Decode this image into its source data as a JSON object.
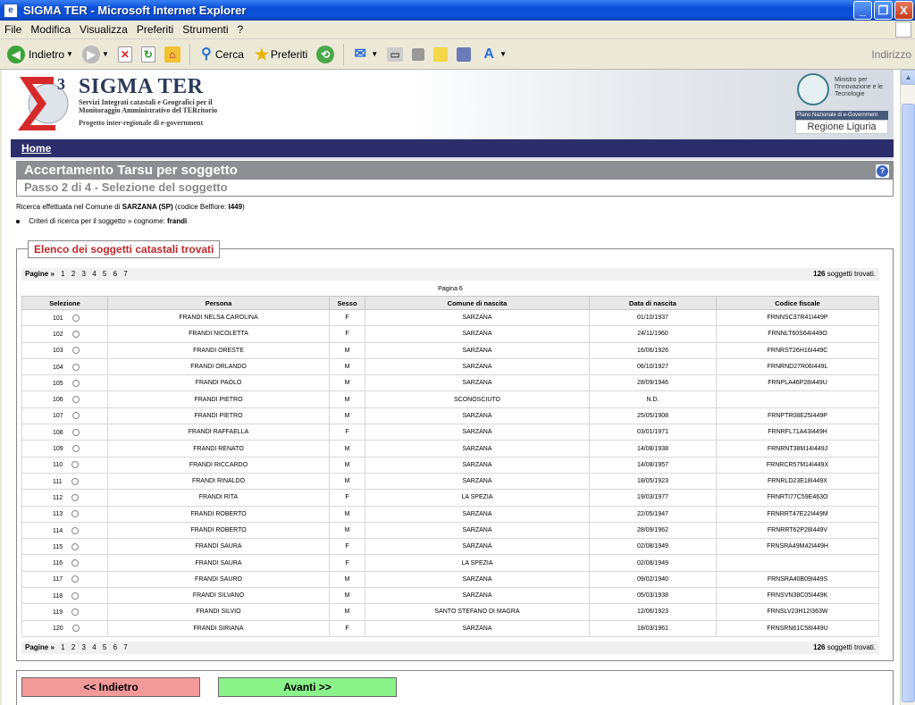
{
  "window": {
    "title": "SIGMA TER - Microsoft Internet Explorer",
    "minimize": "_",
    "maximize": "❐",
    "close": "X"
  },
  "menu": [
    "File",
    "Modifica",
    "Visualizza",
    "Preferiti",
    "Strumenti",
    "?"
  ],
  "toolbar": {
    "back_label": "Indietro",
    "search_label": "Cerca",
    "favorites_label": "Preferiti",
    "address_label": "Indirizzo"
  },
  "banner": {
    "title": "SIGMA TER",
    "subtitle": "Servizi Integrati catastali e Geografici per il Monitoraggio Amministrativo del TERritorio",
    "project": "Progetto inter-regionale di e-government",
    "ministry": "Ministro per l'Innovazione e le Tecnologie",
    "egov": "Piano Nazionale di e-Government",
    "regione": "Regione Liguria"
  },
  "nav": {
    "home": "Home"
  },
  "section": {
    "title": "Accertamento Tarsu per soggetto",
    "step": "Passo 2 di 4 - Selezione del soggetto"
  },
  "info": {
    "line1_prefix": "Ricerca effettuata nel Comune di",
    "comune": "SARZANA (SP)",
    "belfiore_prefix": "(codice Belfiore:",
    "belfiore": "I449",
    "belfiore_suffix": ")",
    "criteria_prefix": "Criteri di ricerca per il soggetto » cognome:",
    "cognome": "frandi"
  },
  "list": {
    "legend": "Elenco dei soggetti catastali trovati",
    "pages_label": "Pagine »",
    "pages": [
      "1",
      "2",
      "3",
      "4",
      "5",
      "6",
      "7"
    ],
    "count": "126",
    "count_suffix": "soggetti trovati.",
    "current_page": "Pagina 6",
    "headers": [
      "Selezione",
      "Persona",
      "Sesso",
      "Comune di nascita",
      "Data di nascita",
      "Codice fiscale"
    ],
    "rows": [
      [
        "101",
        "FRANDI NELSA CAROLINA",
        "F",
        "SARZANA",
        "01/10/1937",
        "FRNNSC37R41I449P"
      ],
      [
        "102",
        "FRANDI NICOLETTA",
        "F",
        "SARZANA",
        "24/11/1960",
        "FRNNLT60S64I449O"
      ],
      [
        "103",
        "FRANDI ORESTE",
        "M",
        "SARZANA",
        "16/06/1926",
        "FRNRST26H16I449C"
      ],
      [
        "104",
        "FRANDI ORLANDO",
        "M",
        "SARZANA",
        "06/10/1927",
        "FRNRND27R06I449L"
      ],
      [
        "105",
        "FRANDI PAOLO",
        "M",
        "SARZANA",
        "28/09/1946",
        "FRNPLA46P28I449U"
      ],
      [
        "106",
        "FRANDI PIETRO",
        "M",
        "SCONOSCIUTO",
        "N.D.",
        ""
      ],
      [
        "107",
        "FRANDI PIETRO",
        "M",
        "SARZANA",
        "25/05/1908",
        "FRNPTR08E25I449P"
      ],
      [
        "108",
        "FRANDI RAFFAELLA",
        "F",
        "SARZANA",
        "03/01/1971",
        "FRNRFL71A43I449H"
      ],
      [
        "109",
        "FRANDI RENATO",
        "M",
        "SARZANA",
        "14/08/1938",
        "FRNRNT38M14I449J"
      ],
      [
        "110",
        "FRANDI RICCARDO",
        "M",
        "SARZANA",
        "14/08/1957",
        "FRNRCR57M14I449X"
      ],
      [
        "111",
        "FRANDI RINALDO",
        "M",
        "SARZANA",
        "18/05/1923",
        "FRNRLD23E18I449X"
      ],
      [
        "112",
        "FRANDI RITA",
        "F",
        "LA SPEZIA",
        "19/03/1977",
        "FRNRTI77C59E463O"
      ],
      [
        "113",
        "FRANDI ROBERTO",
        "M",
        "SARZANA",
        "22/05/1947",
        "FRNRRT47E22I449M"
      ],
      [
        "114",
        "FRANDI ROBERTO",
        "M",
        "SARZANA",
        "28/09/1962",
        "FRNRRT62P28I449V"
      ],
      [
        "115",
        "FRANDI SAURA",
        "F",
        "SARZANA",
        "02/08/1949",
        "FRNSRA49M42I449H"
      ],
      [
        "116",
        "FRANDI SAURA",
        "F",
        "LA SPEZIA",
        "02/08/1949",
        ""
      ],
      [
        "117",
        "FRANDI SAURO",
        "M",
        "SARZANA",
        "09/02/1940",
        "FRNSRA40B09I449S"
      ],
      [
        "118",
        "FRANDI SILVANO",
        "M",
        "SARZANA",
        "05/03/1938",
        "FRNSVN38C05I449K"
      ],
      [
        "119",
        "FRANDI SILVIO",
        "M",
        "SANTO STEFANO DI MAGRA",
        "12/06/1923",
        "FRNSLV23H12I363W"
      ],
      [
        "120",
        "FRANDI SIRIANA",
        "F",
        "SARZANA",
        "18/03/1961",
        "FRNSRN61C58I449U"
      ]
    ]
  },
  "buttons": {
    "back": "<< Indietro",
    "next": "Avanti >>"
  },
  "colors": {
    "nav_bg": "#2b2e6a",
    "back_btn": "#f2999a",
    "next_btn": "#8af38a",
    "legend_text": "#c0282a"
  }
}
